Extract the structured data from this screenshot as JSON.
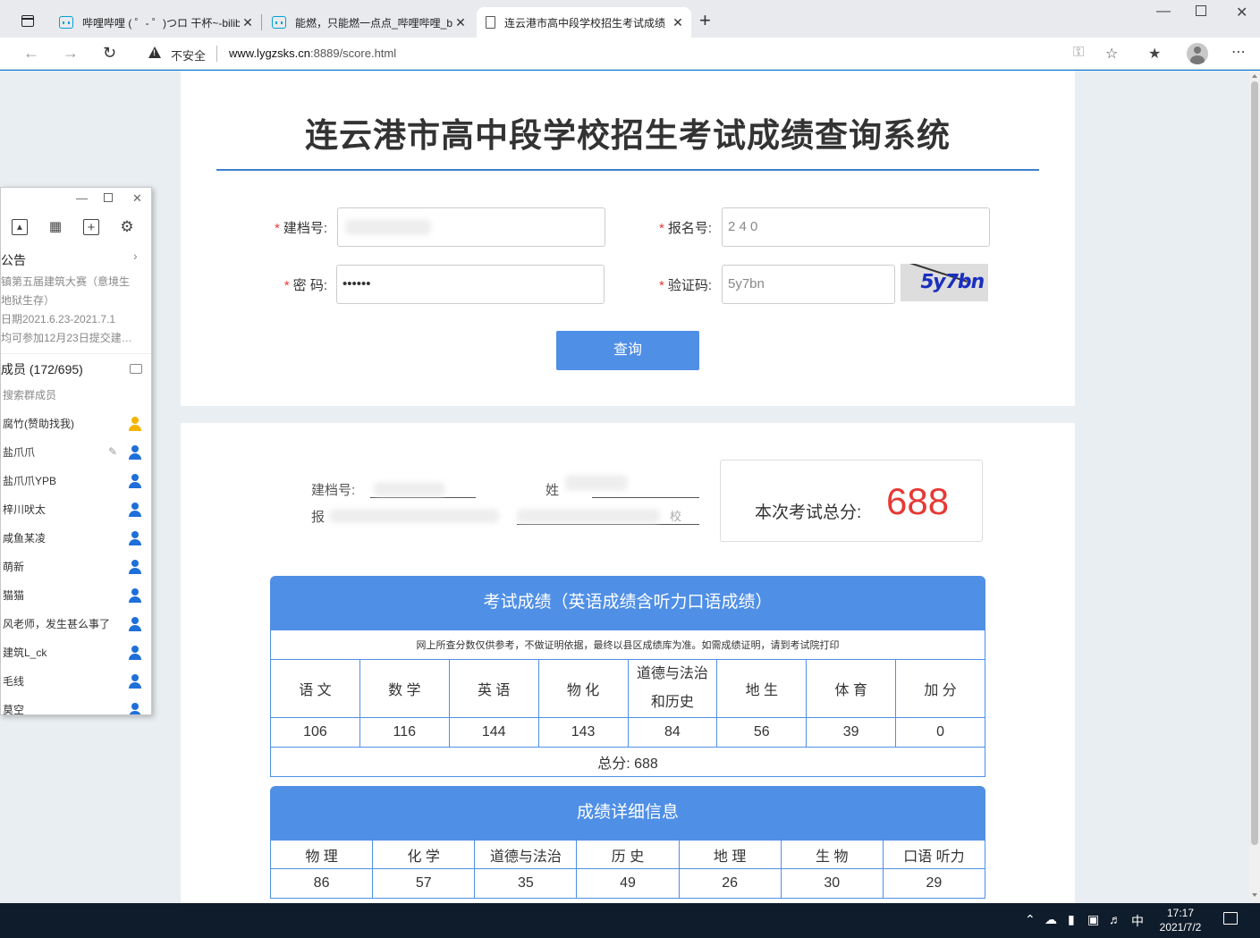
{
  "browser": {
    "tabs": [
      {
        "title": "哔哩哔哩 ( ゜- ゜)つロ 干杯~-bilibi",
        "icon": "bilibili-icon"
      },
      {
        "title": "能燃，只能燃一点点_哔哩哔哩_bi",
        "icon": "bilibili-icon"
      },
      {
        "title": "连云港市高中段学校招生考试成绩",
        "icon": "document-icon"
      }
    ],
    "close_glyph": "✕",
    "new_tab_glyph": "+",
    "insecure_label": "不安全",
    "url_host": "www.lygzsks.cn",
    "url_rest": ":8889/score.html"
  },
  "page": {
    "title": "连云港市高中段学校招生考试成绩查询系统",
    "form": {
      "archive_label": "建档号:",
      "reg_label": "报名号:",
      "reg_value": "2  4  0",
      "password_label": "密 码:",
      "password_value": "••••••",
      "captcha_label": "验证码:",
      "captcha_value": "5y7bn",
      "captcha_image_text": "5y7bn",
      "required_mark": "*",
      "submit_label": "查询"
    },
    "info": {
      "archive_label": "建档号:",
      "name_label": "姓",
      "reg_label": "报",
      "school_suffix": "校"
    },
    "total": {
      "label": "本次考试总分:",
      "value": "688",
      "value_color": "#e53935"
    },
    "scores": {
      "heading": "考试成绩（英语成绩含听力口语成绩）",
      "notice": "网上所查分数仅供参考，不做证明依据，最终以县区成绩库为准。如需成绩证明，请到考试院打印",
      "columns": [
        "语 文",
        "数 学",
        "英 语",
        "物 化",
        "道德与法治和历史",
        "地 生",
        "体 育",
        "加 分"
      ],
      "values": [
        "106",
        "116",
        "144",
        "143",
        "84",
        "56",
        "39",
        "0"
      ],
      "sum_text": "总分:  688"
    },
    "details": {
      "heading": "成绩详细信息",
      "columns": [
        "物 理",
        "化 学",
        "道德与法治",
        "历 史",
        "地 理",
        "生 物",
        "口语 听力"
      ],
      "values": [
        "86",
        "57",
        "35",
        "49",
        "26",
        "30",
        "29"
      ]
    },
    "accent_color": "#4f8fe6"
  },
  "qq": {
    "board_title": "公告",
    "board_lines": [
      "镇第五届建筑大赛（意境生",
      " 地狱生存）",
      "日期2021.6.23-2021.7.1",
      "均可参加12月23日提交建…"
    ],
    "members_title": "成员 (172/695)",
    "search_placeholder": "搜索群成员",
    "members": [
      {
        "name": "腐竹(赞助找我)",
        "color": "#f5b400"
      },
      {
        "name": "盐爪爪",
        "color": "#1e6fd9"
      },
      {
        "name": "盐爪爪YPB",
        "color": "#1e6fd9"
      },
      {
        "name": "梓川吠太",
        "color": "#1e6fd9"
      },
      {
        "name": "咸鱼某凌",
        "color": "#1e6fd9"
      },
      {
        "name": "萌新",
        "color": "#1e6fd9"
      },
      {
        "name": "猫猫",
        "color": "#1e6fd9"
      },
      {
        "name": "风老师，发生甚么事了",
        "color": "#1e6fd9"
      },
      {
        "name": "建筑L_ck",
        "color": "#1e6fd9"
      },
      {
        "name": "毛线",
        "color": "#1e6fd9"
      },
      {
        "name": "莫空",
        "color": "#1e6fd9"
      }
    ]
  },
  "taskbar": {
    "ime": "中",
    "time": "17:17",
    "date": "2021/7/2"
  }
}
